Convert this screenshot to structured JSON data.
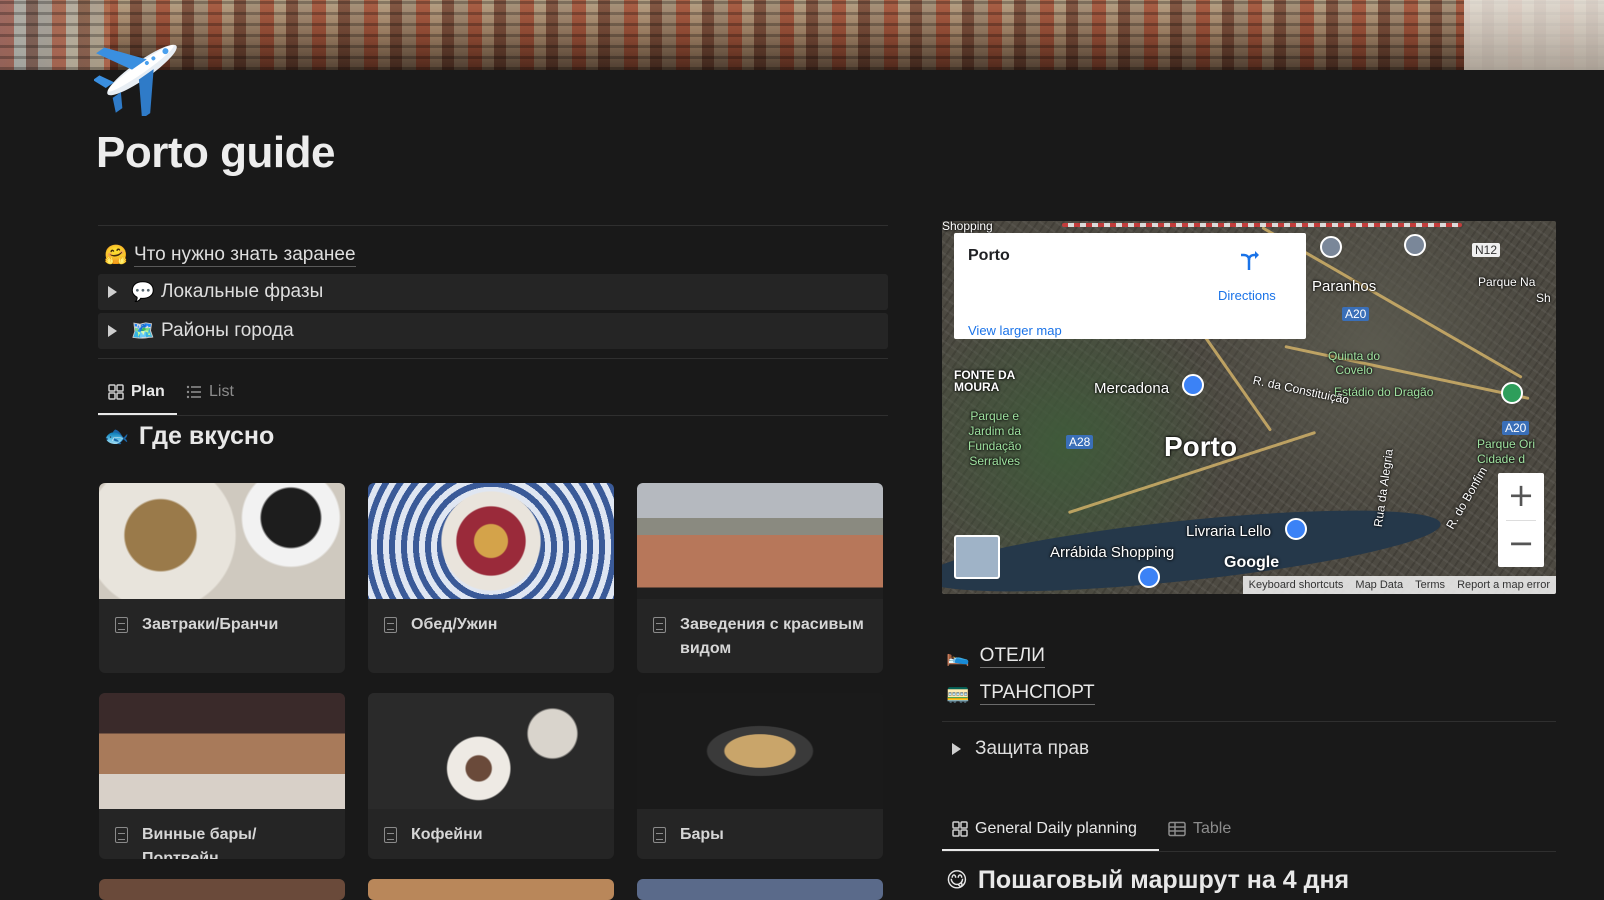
{
  "page": {
    "title": "Porto guide"
  },
  "callouts": [
    {
      "emoji": "🤗",
      "label": "Что нужно знать заранее"
    }
  ],
  "toggles": [
    {
      "emoji": "💬",
      "label": "Локальные фразы"
    },
    {
      "emoji": "🗺️",
      "label": "Районы города"
    }
  ],
  "left_tabs": [
    {
      "label": "Plan",
      "icon": "gallery-icon",
      "active": true
    },
    {
      "label": "List",
      "icon": "list-icon",
      "active": false
    }
  ],
  "food_section": {
    "emoji": "🐟",
    "title": "Где вкусно"
  },
  "gallery": [
    {
      "label": "Завтраки/Бранчи",
      "colors": [
        "#dcd6cc",
        "#9a7a4a",
        "#2b2b2b"
      ]
    },
    {
      "label": "Обед/Ужин",
      "colors": [
        "#4a6aa8",
        "#d4a34a",
        "#9a2a3a"
      ]
    },
    {
      "label": "Заведения с красивым видом",
      "colors": [
        "#b5b9bf",
        "#b7775a",
        "#3a2a28"
      ]
    },
    {
      "label": "Винные бары/Портвейн",
      "colors": [
        "#3a2a2a",
        "#a87a5a",
        "#d8d0c8"
      ]
    },
    {
      "label": "Кофейни",
      "colors": [
        "#2a2a2a",
        "#d9d4cc",
        "#6a4a3a"
      ]
    },
    {
      "label": "Бары",
      "colors": [
        "#1a1a1a",
        "#c9a56a",
        "#3a3a3a"
      ]
    }
  ],
  "map": {
    "place": "Porto",
    "directions": "Directions",
    "view_larger": "View larger map",
    "center_label": "Porto",
    "labels": {
      "shopping": "Shopping",
      "paranhos": "Paranhos",
      "parque_na": "Parque Na",
      "sh": "Sh",
      "quinta": "Quinta do\nCovelo",
      "estadio": "Estádio do Dragão",
      "mercadona": "Mercadona",
      "constituicao": "R. da Constituição",
      "fonte": "FONTE DA\nMOURA",
      "parque_serralves": "Parque e\nJardim da\nFundação\nSerralves",
      "parque_ori": "Parque Ori\nCidade d",
      "livraria": "Livraria Lello",
      "arrabida": "Arrábida Shopping",
      "rua_alegria": "Rua da Alegria",
      "bonfim": "R. do Bonfim",
      "a20": "A20",
      "a28": "A28",
      "n12": "N12",
      "google": "Google"
    },
    "zoom_in": "+",
    "zoom_out": "−",
    "footer": [
      "Keyboard shortcuts",
      "Map Data",
      "Terms",
      "Report a map error"
    ]
  },
  "right_links": [
    {
      "emoji": "🛌",
      "label": "ОТЕЛИ"
    },
    {
      "emoji": "🚃",
      "label": "ТРАНСПОРТ"
    }
  ],
  "right_toggle": {
    "label": "Защита прав"
  },
  "right_tabs": [
    {
      "label": "General Daily planning",
      "icon": "gallery-icon",
      "active": true
    },
    {
      "label": "Table",
      "icon": "table-icon",
      "active": false
    }
  ],
  "route": {
    "emoji": "😋",
    "title": "Пошаговый маршрут на 4 дня"
  }
}
